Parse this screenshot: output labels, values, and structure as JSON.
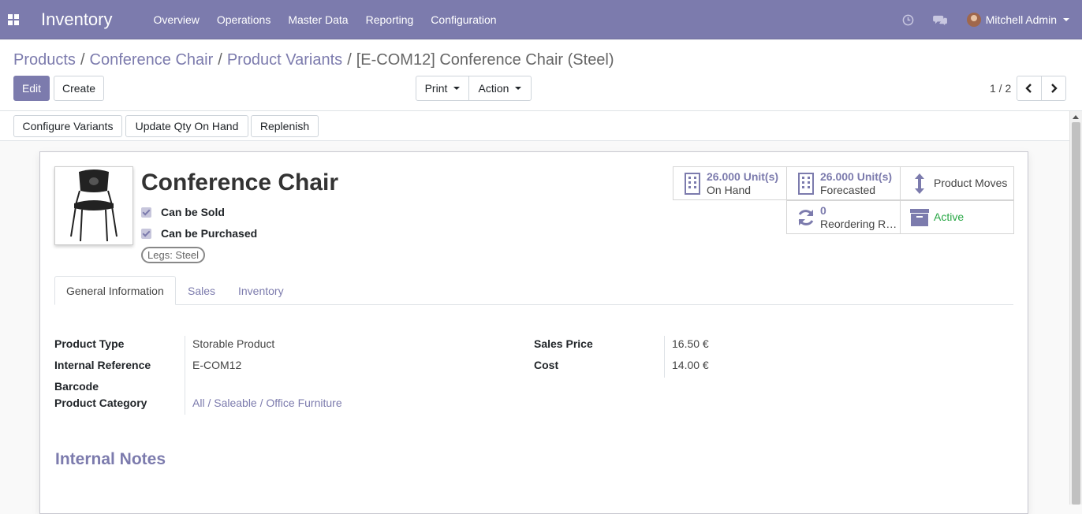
{
  "navbar": {
    "app_name": "Inventory",
    "menu": [
      "Overview",
      "Operations",
      "Master Data",
      "Reporting",
      "Configuration"
    ],
    "user_name": "Mitchell Admin"
  },
  "breadcrumb": {
    "items": [
      "Products",
      "Conference Chair",
      "Product Variants"
    ],
    "current": "[E-COM12] Conference Chair (Steel)"
  },
  "actions": {
    "edit": "Edit",
    "create": "Create",
    "print": "Print",
    "action": "Action",
    "pager": "1 / 2"
  },
  "statusbar": {
    "configure_variants": "Configure Variants",
    "update_qty": "Update Qty On Hand",
    "replenish": "Replenish"
  },
  "product": {
    "name": "Conference Chair",
    "can_be_sold": "Can be Sold",
    "can_be_purchased": "Can be Purchased",
    "attribute": "Legs: Steel"
  },
  "smart_buttons": {
    "on_hand_value": "26.000 Unit(s)",
    "on_hand_label": "On Hand",
    "forecasted_value": "26.000 Unit(s)",
    "forecasted_label": "Forecasted",
    "product_moves": "Product Moves",
    "reordering_value": "0",
    "reordering_label": "Reordering R…",
    "active": "Active"
  },
  "tabs": [
    "General Information",
    "Sales",
    "Inventory"
  ],
  "general": {
    "product_type_label": "Product Type",
    "product_type": "Storable Product",
    "internal_ref_label": "Internal Reference",
    "internal_ref": "E-COM12",
    "barcode_label": "Barcode",
    "category_label": "Product Category",
    "category": "All / Saleable / Office Furniture",
    "sales_price_label": "Sales Price",
    "sales_price": "16.50 €",
    "cost_label": "Cost",
    "cost": "14.00 €"
  },
  "notes_title": "Internal Notes",
  "colors": {
    "brand": "#7c7bad",
    "active_green": "#28a745"
  }
}
